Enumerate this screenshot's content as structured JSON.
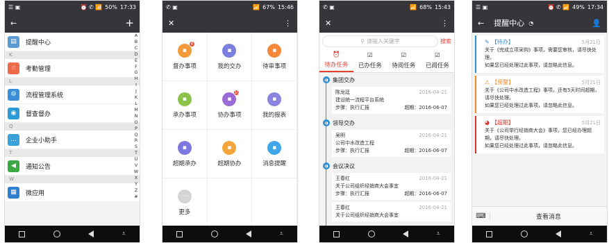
{
  "phone1": {
    "status": {
      "battery": "50%",
      "time": "17:33"
    },
    "back": "←",
    "plus": "+",
    "items": [
      {
        "type": "item",
        "label": "提醒中心",
        "color": "#5b9bd5",
        "icon": "clipboard-icon"
      },
      {
        "type": "group",
        "label": "K"
      },
      {
        "type": "item",
        "label": "考勤管理",
        "color": "#ef6a4a",
        "icon": "hand-icon"
      },
      {
        "type": "group",
        "label": "L"
      },
      {
        "type": "item",
        "label": "流程管理系统",
        "color": "#3b8ed8",
        "icon": "flow-icon"
      },
      {
        "type": "item",
        "label": "督查督办",
        "color": "#2a9bd6",
        "icon": "eye-icon"
      },
      {
        "type": "group",
        "label": "Q"
      },
      {
        "type": "item",
        "label": "企业小助手",
        "color": "#39a3d9",
        "icon": "chat-icon"
      },
      {
        "type": "group",
        "label": "T"
      },
      {
        "type": "item",
        "label": "通知公告",
        "color": "#3aa843",
        "icon": "speaker-icon"
      },
      {
        "type": "group",
        "label": "W"
      },
      {
        "type": "item",
        "label": "微应用",
        "color": "#2f7fd0",
        "icon": "app-icon"
      }
    ],
    "alphabet": [
      "A",
      "B",
      "C",
      "D",
      "E",
      "F",
      "G",
      "H",
      "I",
      "J",
      "K",
      "L",
      "M",
      "N",
      "O",
      "P",
      "Q",
      "R",
      "S",
      "T",
      "U",
      "V",
      "W",
      "X",
      "Y",
      "Z",
      "#"
    ]
  },
  "phone2": {
    "status": {
      "battery": "67%",
      "time": "15:46"
    },
    "close": "✕",
    "more": "⋮",
    "cells": [
      {
        "label": "督办事项",
        "color": "#f39a3a",
        "badge": "4"
      },
      {
        "label": "我的交办",
        "color": "#7b7fe0",
        "badge": ""
      },
      {
        "label": "待审事项",
        "color": "#f5893a",
        "badge": ""
      },
      {
        "label": "承办事项",
        "color": "#8bc34a",
        "badge": ""
      },
      {
        "label": "协办事项",
        "color": "#9a6bd6",
        "badge": "10"
      },
      {
        "label": "我的报表",
        "color": "#8a84df",
        "badge": ""
      },
      {
        "label": "超期承办",
        "color": "#7d78e0",
        "badge": ""
      },
      {
        "label": "超期协办",
        "color": "#f3a43a",
        "badge": ""
      },
      {
        "label": "消息提醒",
        "color": "#3fa6e8",
        "badge": ""
      },
      {
        "label": "更多",
        "color": "#d5d5d5",
        "badge": ""
      }
    ]
  },
  "phone3": {
    "status": {
      "battery": "68%",
      "time": "15:43"
    },
    "close": "✕",
    "more": "⋮",
    "search_placeholder": "请输入关键字",
    "search_button": "搜索",
    "tabs": [
      "待办任务",
      "已办任务",
      "待阅任务",
      "已阅任务"
    ],
    "sections": [
      {
        "title": "集团交办",
        "items": [
          {
            "name": "陈龙廷",
            "date": "2016-04-21",
            "text": "建设统一流程平台系统",
            "step": "步骤：执行汇报",
            "due": "超期：2016-06-07"
          }
        ]
      },
      {
        "title": "领导交办",
        "items": [
          {
            "name": "吴明",
            "date": "2016-04-21",
            "text": "公司中水改造工程",
            "step": "步骤：执行汇报",
            "due": "超期：2016-06-07"
          }
        ]
      },
      {
        "title": "会议决议",
        "items": [
          {
            "name": "王春红",
            "date": "2016-04-21",
            "text": "关于公司组织经销商大会事宜",
            "step": "步骤：执行汇报",
            "due": "超期：2016-06-07"
          },
          {
            "name": "王春红",
            "date": "2016-04-21",
            "text": "关于公司组织经销商大会事宜",
            "step": "",
            "due": ""
          }
        ]
      }
    ]
  },
  "phone4": {
    "status": {
      "battery": "49%",
      "time": "17:34"
    },
    "back": "←",
    "title": "提醒中心",
    "cards": [
      {
        "tag": "【待办】",
        "color": "#2d8fd5",
        "date": "5月21日",
        "text": "关于《完成立项采购》事项，需要您审核，请尽快处理。",
        "note": "如果您已经处理过此事项，请忽略此信息。"
      },
      {
        "tag": "【预警】",
        "color": "#f08a24",
        "date": "5月21日",
        "text": "关于《公司中水改造工程》事项，还有5天时间超期，请尽快处理。",
        "note": "如果您已经处理过此事项，请忽略此信息。"
      },
      {
        "tag": "【超期】",
        "color": "#d9322a",
        "date": "5月21日",
        "text": "关于《公司举行经销商大会》事项，您已经办理超期，请尽快处理。",
        "note": "如果您已经处理过此事项，请忽略此信息。"
      }
    ],
    "bottom": "查看消息"
  }
}
